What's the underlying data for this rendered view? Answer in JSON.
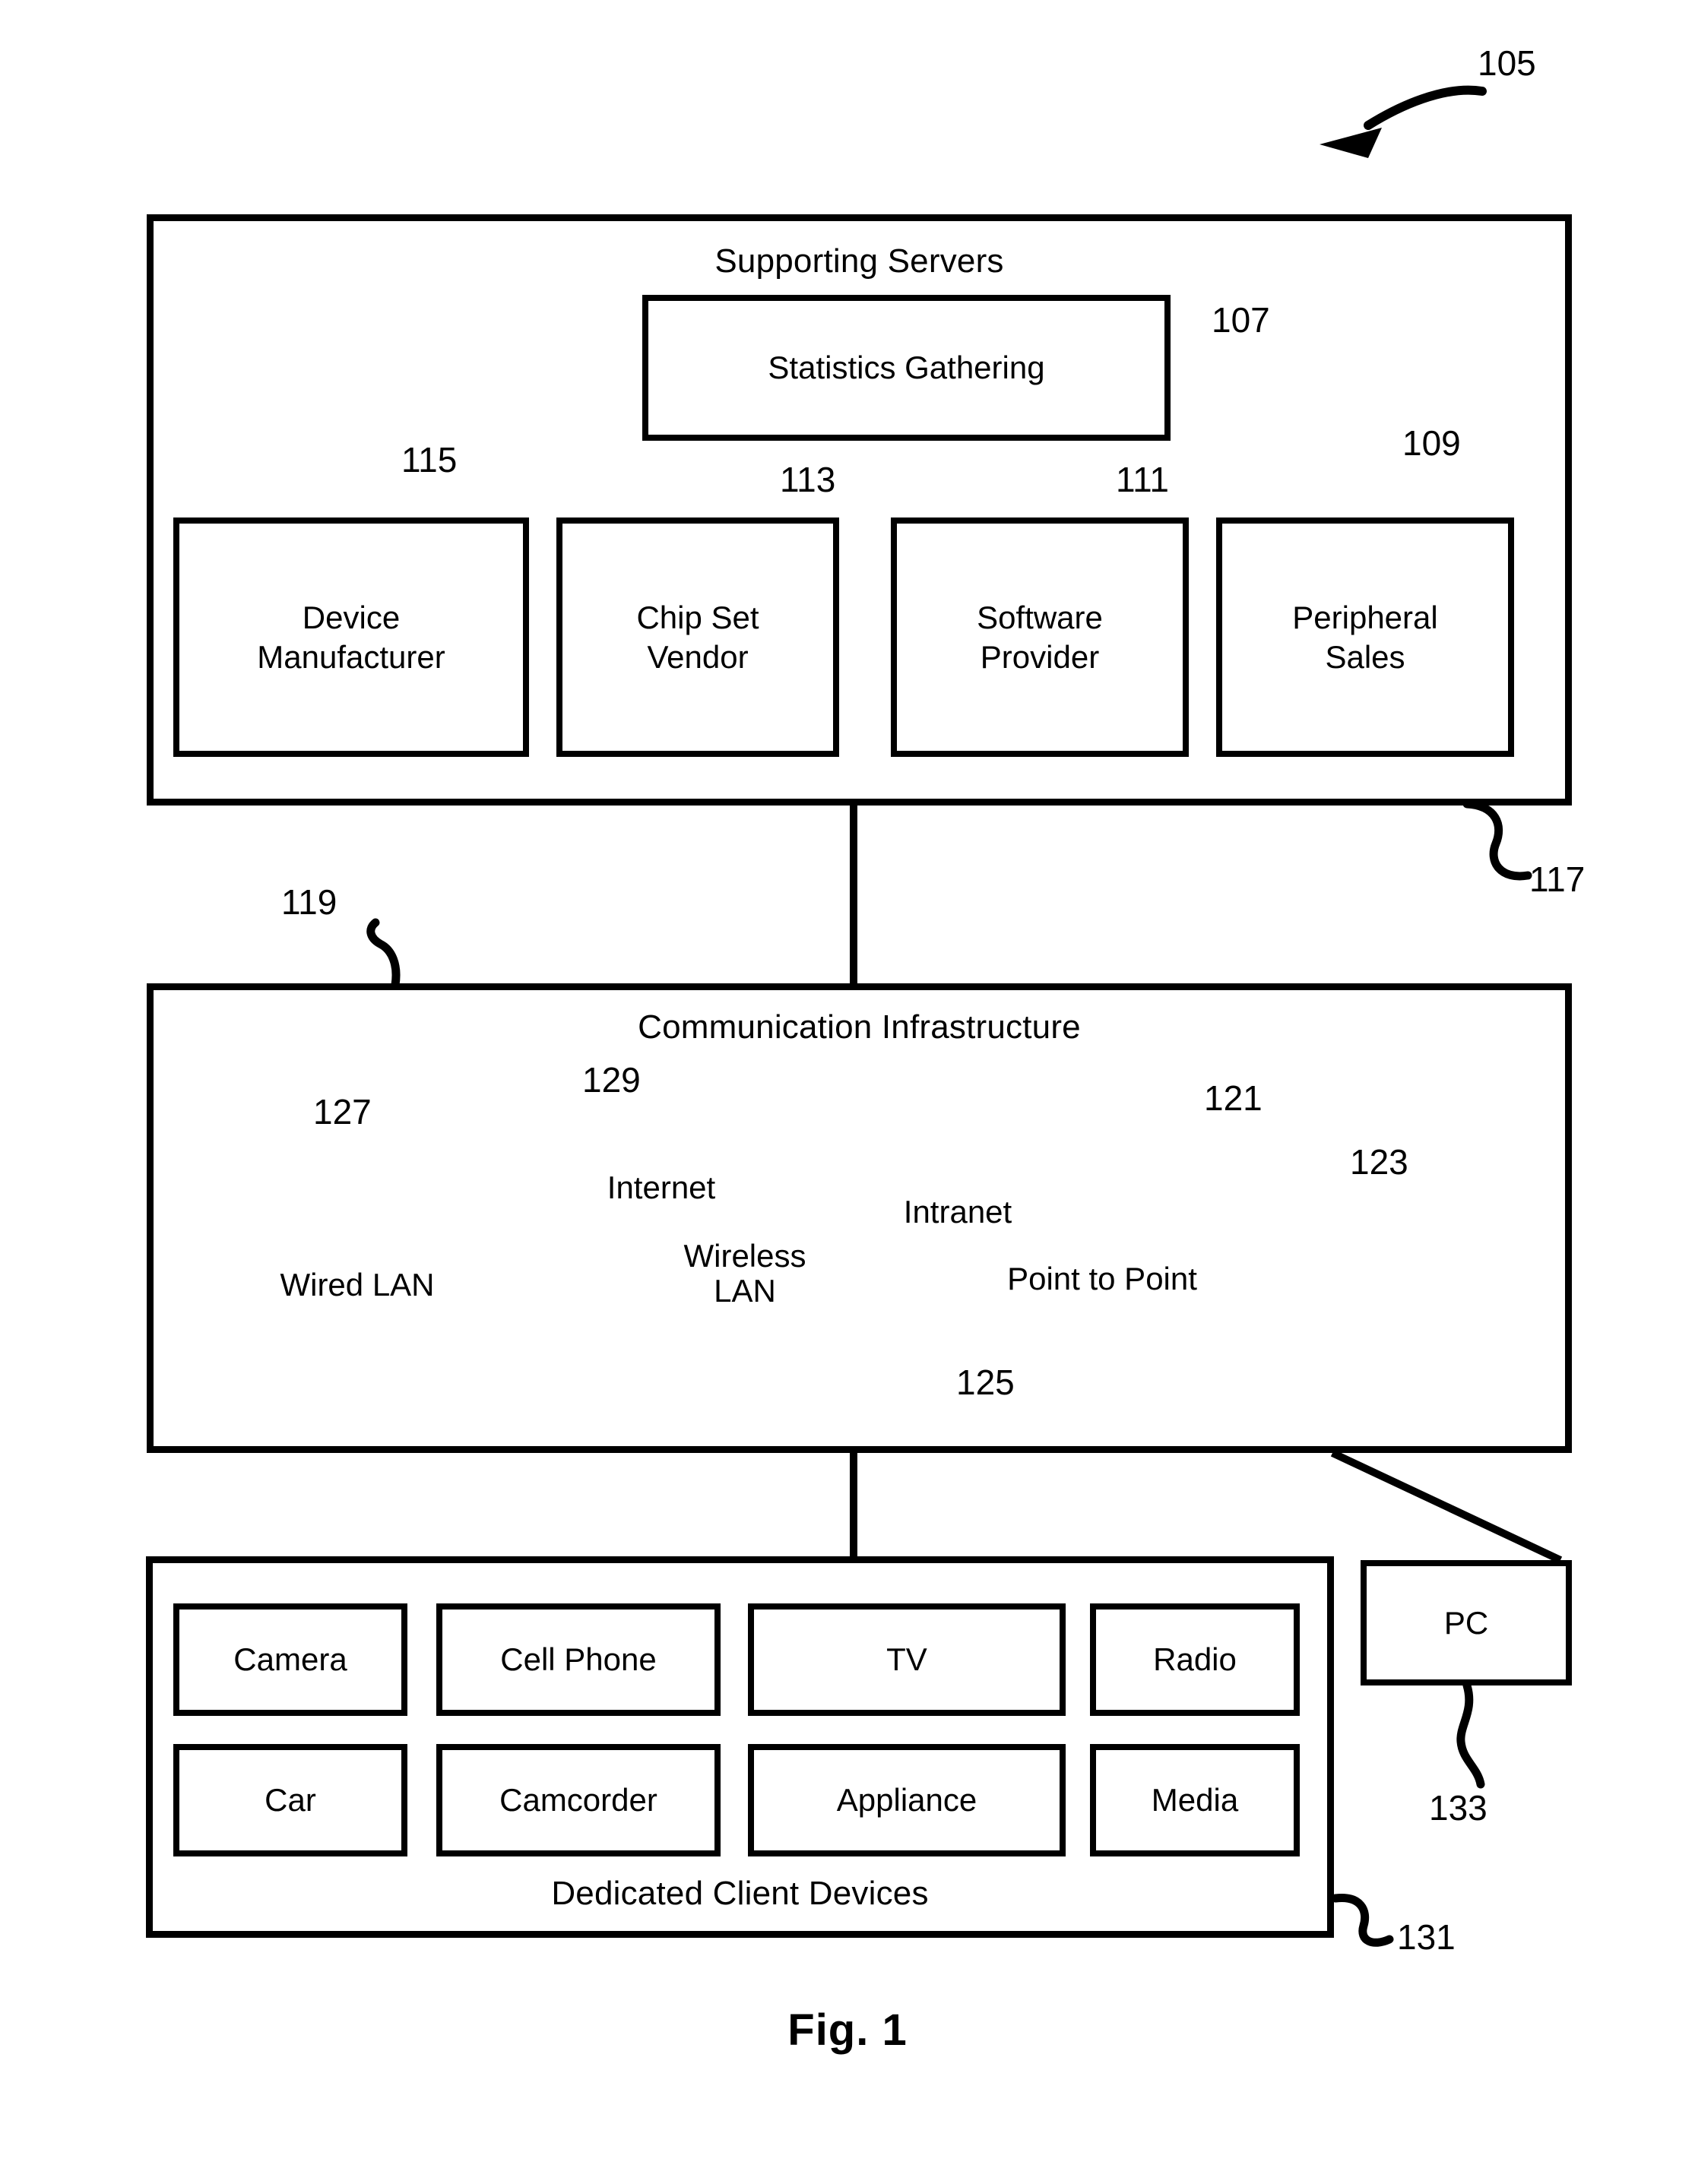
{
  "figure": {
    "caption": "Fig. 1",
    "system_ref": "105"
  },
  "supporting_servers": {
    "title": "Supporting Servers",
    "ref": "117",
    "statistics": {
      "label": "Statistics Gathering",
      "ref": "107"
    },
    "servers": [
      {
        "label_line1": "Device",
        "label_line2": "Manufacturer",
        "ref": "115"
      },
      {
        "label_line1": "Chip Set",
        "label_line2": "Vendor",
        "ref": "113"
      },
      {
        "label_line1": "Software",
        "label_line2": "Provider",
        "ref": "111"
      },
      {
        "label_line1": "Peripheral",
        "label_line2": "Sales",
        "ref": "109"
      }
    ]
  },
  "communication_infrastructure": {
    "title": "Communication Infrastructure",
    "ref": "119",
    "networks": [
      {
        "label": "Wired LAN",
        "ref": "127"
      },
      {
        "label": "Internet",
        "ref": "129"
      },
      {
        "label": "Intranet",
        "ref": "121"
      },
      {
        "label": "Wireless LAN",
        "label_line1": "Wireless",
        "label_line2": "LAN",
        "ref": "125"
      },
      {
        "label": "Point to Point",
        "ref": "123"
      }
    ]
  },
  "client_devices": {
    "title": "Dedicated Client Devices",
    "ref": "131",
    "devices": [
      {
        "label": "Camera"
      },
      {
        "label": "Cell Phone"
      },
      {
        "label": "TV"
      },
      {
        "label": "Radio"
      },
      {
        "label": "Car"
      },
      {
        "label": "Camcorder"
      },
      {
        "label": "Appliance"
      },
      {
        "label": "Media"
      }
    ]
  },
  "pc": {
    "label": "PC",
    "ref": "133"
  }
}
